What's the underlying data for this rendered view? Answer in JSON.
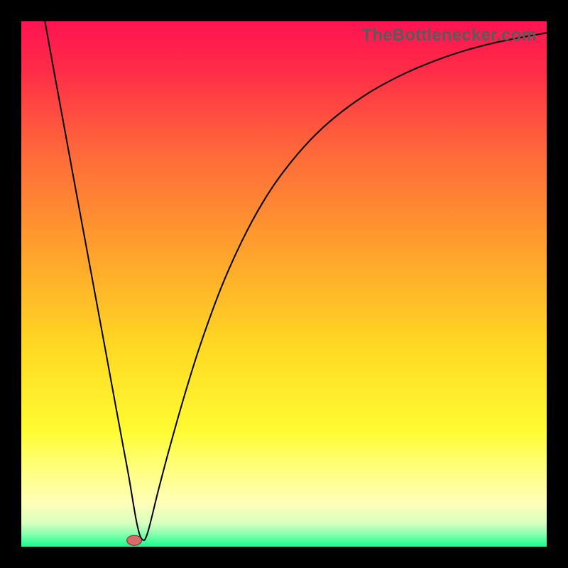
{
  "watermark": "TheBottlenecker.com",
  "chart_data": {
    "type": "line",
    "title": "",
    "xlabel": "",
    "ylabel": "",
    "xlim": [
      0,
      100
    ],
    "ylim": [
      0,
      100
    ],
    "background_gradient_stops": [
      {
        "offset": 0,
        "color": "#ff1452"
      },
      {
        "offset": 0.09,
        "color": "#ff2b48"
      },
      {
        "offset": 0.25,
        "color": "#ff693a"
      },
      {
        "offset": 0.45,
        "color": "#ffa52c"
      },
      {
        "offset": 0.62,
        "color": "#ffd923"
      },
      {
        "offset": 0.78,
        "color": "#fffb32"
      },
      {
        "offset": 0.85,
        "color": "#ffff7d"
      },
      {
        "offset": 0.915,
        "color": "#ffffb8"
      },
      {
        "offset": 0.955,
        "color": "#d9ffc0"
      },
      {
        "offset": 0.975,
        "color": "#8dffb0"
      },
      {
        "offset": 1.0,
        "color": "#12ff8f"
      }
    ],
    "series": [
      {
        "name": "bottleneck-curve",
        "color": "#000000",
        "x": [
          4.5,
          6,
          8,
          10,
          12,
          14,
          16,
          18,
          19.5,
          20.5,
          22,
          23,
          24,
          26,
          28,
          31,
          34,
          38,
          42,
          46,
          50,
          55,
          60,
          66,
          72,
          78,
          84,
          90,
          96,
          100
        ],
        "y": [
          100,
          91.7,
          80.8,
          69.9,
          59.1,
          48.3,
          37.5,
          26.6,
          18.5,
          13.1,
          4.4,
          1.4,
          2.5,
          10.4,
          18.0,
          28.6,
          38.2,
          49.2,
          58.2,
          65.6,
          71.5,
          77.4,
          82.0,
          86.3,
          89.6,
          92.2,
          94.3,
          95.9,
          97.1,
          97.8
        ]
      }
    ],
    "marker": {
      "name": "optimal-point",
      "x": 21.5,
      "y": 1.2,
      "rx": 1.4,
      "ry": 0.95,
      "fill": "#d86a6a",
      "stroke": "#6a1a1a"
    }
  }
}
